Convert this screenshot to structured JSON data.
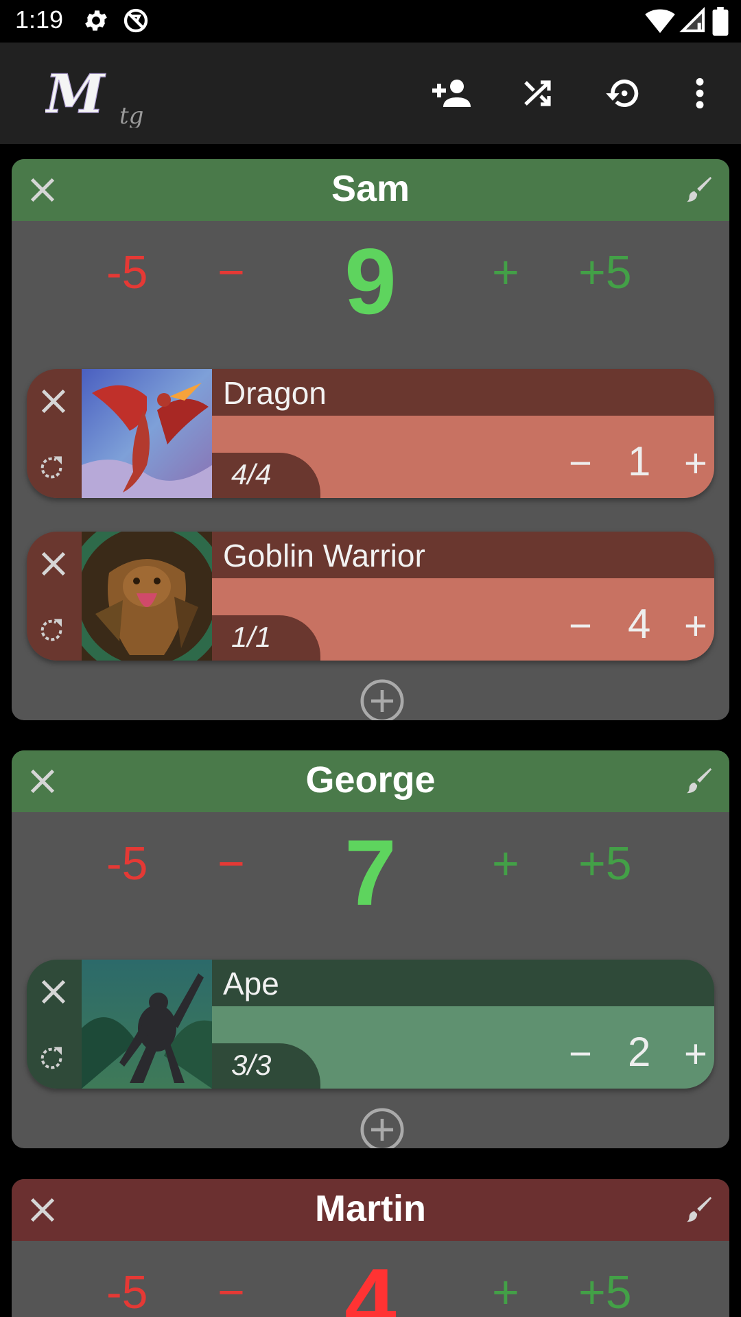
{
  "status_bar": {
    "time": "1:19",
    "icons": [
      "gear-icon",
      "sync-disabled-icon",
      "wifi-icon",
      "signal-icon",
      "battery-icon"
    ]
  },
  "app_bar": {
    "logo_text": "Mtg",
    "actions": [
      "add-player-icon",
      "shuffle-icon",
      "reset-icon",
      "more-vert-icon"
    ]
  },
  "colors": {
    "header_green": "#4a7a4a",
    "header_red": "#6b3030",
    "life_green": "#5ed45e",
    "life_red": "#ff3333",
    "card_bg": "#555555"
  },
  "life_controls": {
    "minus5": "-5",
    "minus1": "−",
    "plus1": "+",
    "plus5": "+5"
  },
  "players": [
    {
      "name": "Sam",
      "life": "9",
      "creatures": [
        {
          "name": "Dragon",
          "pt": "4/4",
          "count": "1",
          "minus": "−",
          "plus": "+"
        },
        {
          "name": "Goblin Warrior",
          "pt": "1/1",
          "count": "4",
          "minus": "−",
          "plus": "+"
        }
      ]
    },
    {
      "name": "George",
      "life": "7",
      "creatures": [
        {
          "name": "Ape",
          "pt": "3/3",
          "count": "2",
          "minus": "−",
          "plus": "+"
        }
      ]
    },
    {
      "name": "Martin",
      "life": "4",
      "creatures": []
    }
  ]
}
